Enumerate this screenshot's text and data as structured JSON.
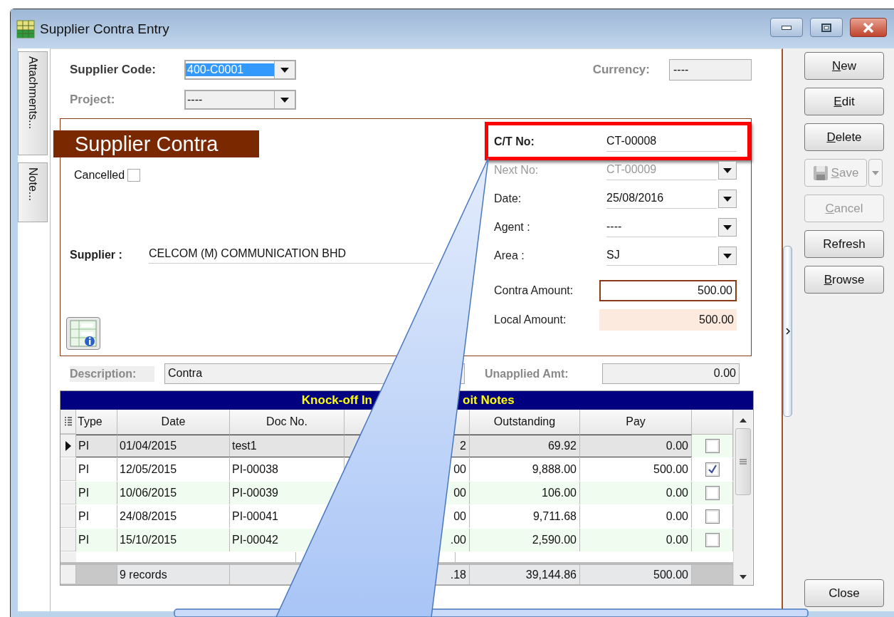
{
  "window": {
    "title": "Supplier Contra Entry"
  },
  "side_tabs": [
    {
      "label": "Attachments..."
    },
    {
      "label": "Note..."
    }
  ],
  "header_fields": [
    {
      "label": "Supplier Code:",
      "value": "400-C0001",
      "kind": "dropdown",
      "disabled": false,
      "text_selected": true
    },
    {
      "label": "Project:",
      "value": "----",
      "kind": "dropdown",
      "disabled": true,
      "text_selected": false
    },
    {
      "label": "Currency:",
      "value": "----",
      "kind": "text",
      "disabled": true,
      "text_selected": false
    }
  ],
  "document_banner": "Supplier Contra",
  "cancelled": {
    "label": "Cancelled",
    "checked": false
  },
  "supplier": {
    "label": "Supplier :",
    "value": "CELCOM (M) COMMUNICATION BHD"
  },
  "detail_fields": [
    {
      "label": "C/T No:",
      "value": "CT-00008",
      "kind": "docno",
      "disabled": false,
      "highlighted": true
    },
    {
      "label": "Next No:",
      "value": "CT-00009",
      "kind": "dropdown",
      "disabled": true,
      "highlighted": false
    },
    {
      "label": "Date:",
      "value": "25/08/2016",
      "kind": "dropdown",
      "disabled": false,
      "highlighted": false
    },
    {
      "label": "Agent :",
      "value": "----",
      "kind": "dropdown",
      "disabled": false,
      "highlighted": false
    },
    {
      "label": "Area :",
      "value": "SJ",
      "kind": "dropdown",
      "disabled": false,
      "highlighted": false
    },
    {
      "label": "Contra Amount:",
      "value": "500.00",
      "kind": "amount",
      "disabled": false,
      "highlighted": false
    },
    {
      "label": "Local Amount:",
      "value": "500.00",
      "kind": "readonly-amount",
      "disabled": false,
      "highlighted": false
    }
  ],
  "description": {
    "label": "Description:",
    "value": "Contra"
  },
  "unapplied": {
    "label": "Unapplied Amt:",
    "value": "0.00"
  },
  "knockoff_table": {
    "title_parts": [
      "Knock-off In",
      "oit Notes"
    ],
    "columns": [
      "Type",
      "Date",
      "Doc No.",
      "Outstanding",
      "Pay"
    ],
    "rows": [
      {
        "type": "PI",
        "date": "01/04/2015",
        "doc_no": "test1",
        "column_4": "2",
        "outstanding": "69.92",
        "pay": "0.00",
        "checked": false,
        "selected": true
      },
      {
        "type": "PI",
        "date": "12/05/2015",
        "doc_no": "PI-00038",
        "column_4": "00",
        "outstanding": "9,888.00",
        "pay": "500.00",
        "checked": true,
        "selected": false
      },
      {
        "type": "PI",
        "date": "10/06/2015",
        "doc_no": "PI-00039",
        "column_4": "00",
        "outstanding": "106.00",
        "pay": "0.00",
        "checked": false,
        "selected": false
      },
      {
        "type": "PI",
        "date": "24/08/2015",
        "doc_no": "PI-00041",
        "column_4": "00",
        "outstanding": "9,711.68",
        "pay": "0.00",
        "checked": false,
        "selected": false
      },
      {
        "type": "PI",
        "date": "15/10/2015",
        "doc_no": "PI-00042",
        "column_4": ".00",
        "outstanding": "2,590.00",
        "pay": "0.00",
        "checked": false,
        "selected": false
      }
    ],
    "footer": {
      "date": "9 records",
      "column_4": ".18",
      "outstanding": "39,144.86",
      "pay": "500.00"
    }
  },
  "buttons": [
    {
      "label": "New",
      "underline_first": true,
      "disabled": false,
      "kind": "plain"
    },
    {
      "label": "Edit",
      "underline_first": true,
      "disabled": false,
      "kind": "plain"
    },
    {
      "label": "Delete",
      "underline_first": true,
      "disabled": false,
      "kind": "plain"
    },
    {
      "label": "Save",
      "underline_first": true,
      "disabled": true,
      "kind": "split"
    },
    {
      "label": "Cancel",
      "underline_first": true,
      "disabled": true,
      "kind": "plain"
    },
    {
      "label": "Refresh",
      "underline_first": false,
      "disabled": false,
      "kind": "plain"
    },
    {
      "label": "Browse",
      "underline_first": true,
      "disabled": false,
      "kind": "plain"
    },
    {
      "label": "Close",
      "underline_first": false,
      "disabled": false,
      "kind": "footer"
    }
  ]
}
